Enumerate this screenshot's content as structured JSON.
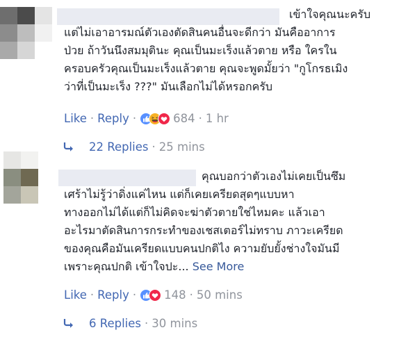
{
  "comments": [
    {
      "text_lines": [
        "เข้าใจคุณนะครับ",
        "แต่ไม่เอาอารมณ์ตัวเองตัดสินคนอื่นจะดีกว่า มันคืออาการ",
        "ป่วย ถ้าวันนึงสมมุตินะ คุณเป็นมะเร็งแล้วตาย หรือ ใครใน",
        "ครอบครัวคุณเป็นมะเร็งแล้วตาย คุณจะพูดมั้ยว่า \"กูโกรธเมิง",
        "ว่าที่เป็นมะเร็ง ???\" มันเลือกไม่ได้หรอกครับ"
      ],
      "like_label": "Like",
      "reply_label": "Reply",
      "reaction_count": "684",
      "time": "1 hr",
      "replies_label": "22 Replies",
      "replies_time": "25 mins"
    },
    {
      "text_lines": [
        "คุณบอกว่าตัวเองไม่เคยเป็นซึม",
        "เศร้าไม่รู้ว่าดิ่งแค่ไหน แต่ก็เคยเครียดสุดๆแบบหา",
        "ทางออกไม่ได้แต่ก็ไม่คิดจะฆ่าตัวตายใช่ไหมคะ แล้วเอา",
        "อะไรมาตัดสินการกระทำของเชสเตอร์ไม่ทราบ ภาวะเครียด",
        "ของคุณคือมันเครียดแบบคนปกติไง ความยับยั้งช่างใจมันมี",
        "เพราะคุณปกติ เข้าใจปะ..."
      ],
      "see_more_label": "See More",
      "like_label": "Like",
      "reply_label": "Reply",
      "reaction_count": "148",
      "time": "50 mins",
      "replies_label": "6 Replies",
      "replies_time": "30 mins"
    }
  ],
  "colors": {
    "link": "#4267b2",
    "meta": "#90949c",
    "text": "#1d2129",
    "like_blue": "#5890ff",
    "haha_yellow": "#f7b125",
    "love_red": "#f0284a"
  },
  "icons": {
    "reply_arrow": "reply-arrow-icon",
    "reactions_1": [
      "like-reaction-icon",
      "haha-reaction-icon",
      "love-reaction-icon"
    ],
    "reactions_2": [
      "like-reaction-icon",
      "love-reaction-icon"
    ]
  }
}
